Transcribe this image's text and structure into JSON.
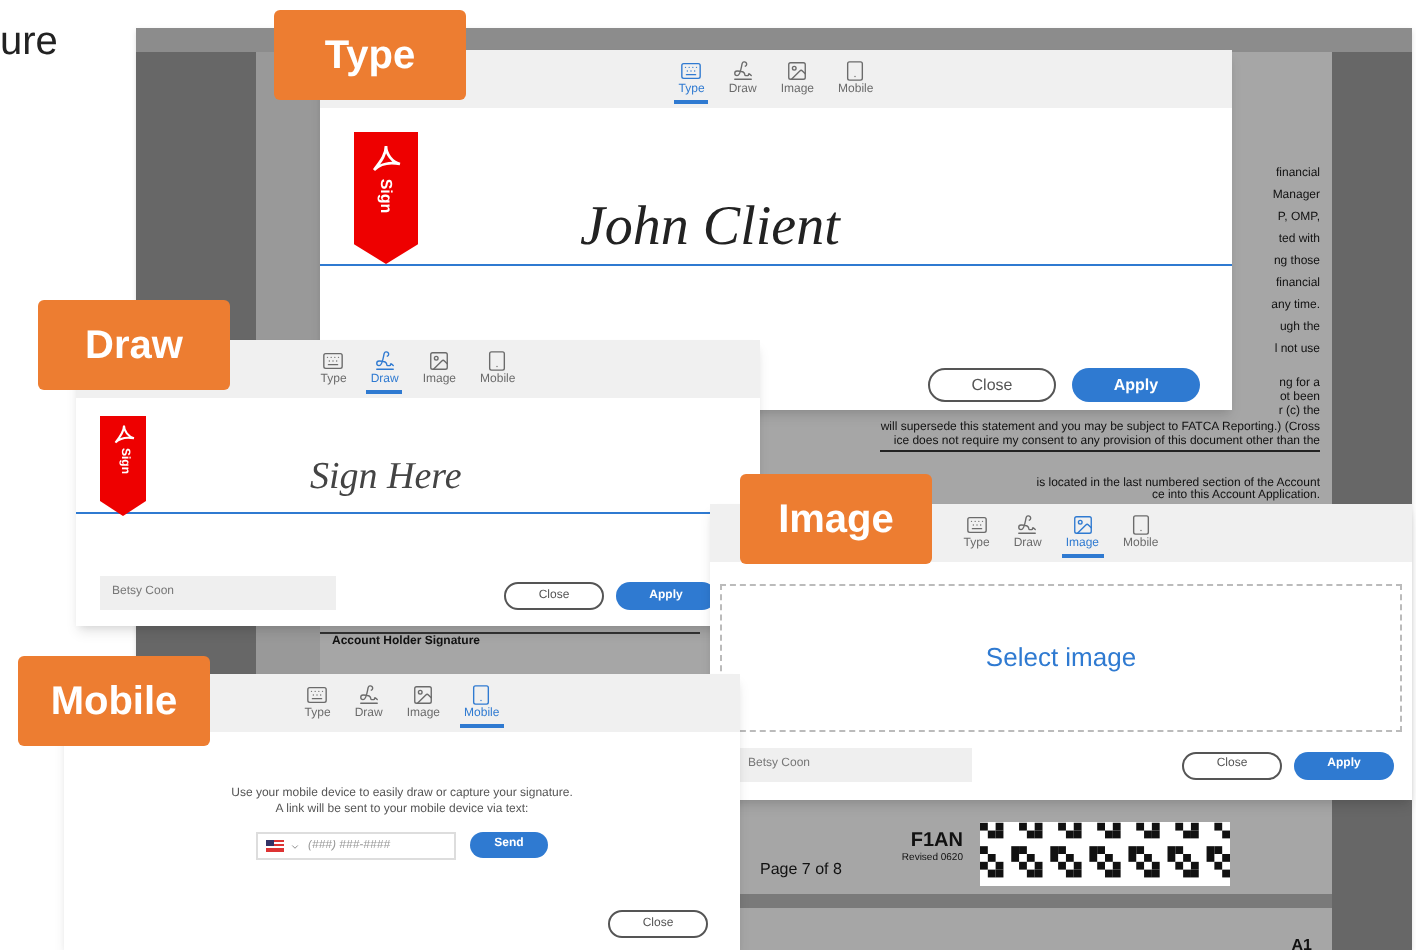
{
  "heading_fragment": "ure",
  "document": {
    "side_lines": [
      "financial",
      "Manager",
      "P, OMP,",
      "ted with",
      "ng those",
      "financial",
      "any time.",
      "ugh the",
      "l not use"
    ],
    "lower_right_lines": [
      "ng for a",
      "ot been",
      "r (c) the"
    ],
    "body_lines": [
      "will supersede this statement and you may be subject to FATCA Reporting.) (Cross",
      "ice does not require my consent to any provision of this document other than the"
    ],
    "account_lines": [
      "is located in the last numbered section of the Account",
      "ce into this Account Application."
    ],
    "signature_caption": "Account Holder Signature",
    "form_code": "F1AN",
    "revision": "Revised 0620",
    "page": "Page 7 of 8",
    "next_page_code": "A1"
  },
  "dialogs": [
    {
      "kind": "type",
      "callout": "Type",
      "flag_label": "Sign",
      "signature": "John Client",
      "tabs": [
        {
          "label": "Type",
          "selected": true
        },
        {
          "label": "Draw",
          "selected": false
        },
        {
          "label": "Image",
          "selected": false
        },
        {
          "label": "Mobile",
          "selected": false
        }
      ],
      "buttons": [
        "Close",
        "Apply"
      ]
    },
    {
      "kind": "draw",
      "callout": "Draw",
      "flag_label": "Sign",
      "signature": "Sign Here",
      "name": "Betsy Coon",
      "tabs": [
        {
          "label": "Type",
          "selected": false
        },
        {
          "label": "Draw",
          "selected": true
        },
        {
          "label": "Image",
          "selected": false
        },
        {
          "label": "Mobile",
          "selected": false
        }
      ],
      "buttons": [
        "Close",
        "Apply"
      ]
    },
    {
      "kind": "image",
      "callout": "Image",
      "prompt": "Select image",
      "name": "Betsy Coon",
      "tabs": [
        {
          "label": "Type",
          "selected": false
        },
        {
          "label": "Draw",
          "selected": false
        },
        {
          "label": "Image",
          "selected": true
        },
        {
          "label": "Mobile",
          "selected": false
        }
      ],
      "buttons": [
        "Close",
        "Apply"
      ]
    },
    {
      "kind": "mobile",
      "callout": "Mobile",
      "instructions": [
        "Use your mobile device to easily draw or capture your signature.",
        "A link will be sent to your mobile device via text:"
      ],
      "phone": {
        "placeholder": "(###) ###-####"
      },
      "send": "Send",
      "tabs": [
        {
          "label": "Type",
          "selected": false
        },
        {
          "label": "Draw",
          "selected": false
        },
        {
          "label": "Image",
          "selected": false
        },
        {
          "label": "Mobile",
          "selected": true
        }
      ],
      "buttons": [
        "Close"
      ]
    }
  ]
}
